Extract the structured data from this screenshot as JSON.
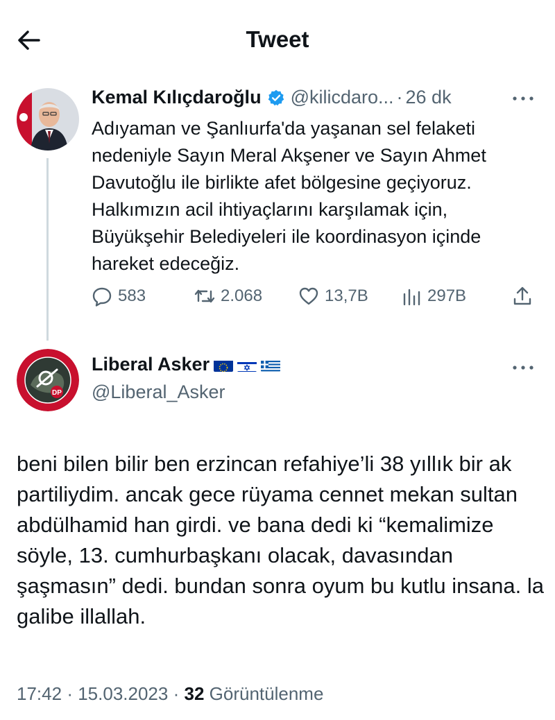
{
  "header": {
    "title": "Tweet"
  },
  "quoted_tweet": {
    "display_name": "Kemal Kılıçdaroğlu",
    "handle": "@kilicdaro...",
    "separator": "·",
    "time": "26 dk",
    "text": "Adıyaman ve Şanlıurfa'da yaşanan sel felaketi nedeniyle Sayın Meral Akşener ve Sayın Ahmet Davutoğlu ile birlikte afet bölgesine geçiyoruz. Halkımızın acil ihtiyaçlarını karşılamak için, Büyükşehir Belediyeleri ile koordinasyon içinde hareket edeceğiz.",
    "actions": {
      "replies": "583",
      "retweets": "2.068",
      "likes": "13,7B",
      "views": "297B"
    }
  },
  "main_tweet": {
    "display_name": "Liberal Asker",
    "handle": "@Liberal_Asker",
    "flags": [
      "eu-flag",
      "israel-flag",
      "greece-flag"
    ],
    "avatar_text": "DP",
    "text": "beni bilen bilir ben erzincan refahiye’li 38 yıllık bir ak partiliydim. ancak gece rüyama cennet mekan sultan abdülhamid han girdi. ve bana dedi ki “kemalimize söyle, 13. cumhurbaşkanı olacak, davasından şaşmasın” dedi. bundan sonra oyum bu kutlu insana. la galibe illallah.",
    "time": "17:42",
    "date": "15.03.2023",
    "dot": "·",
    "views_count": "32",
    "views_label": "Görüntülenme"
  },
  "colors": {
    "text": "#0f1419",
    "secondary": "#536471",
    "verified": "#1d9bf0",
    "thread_line": "#cfd9de",
    "avatar_ring": "#c8102e"
  }
}
